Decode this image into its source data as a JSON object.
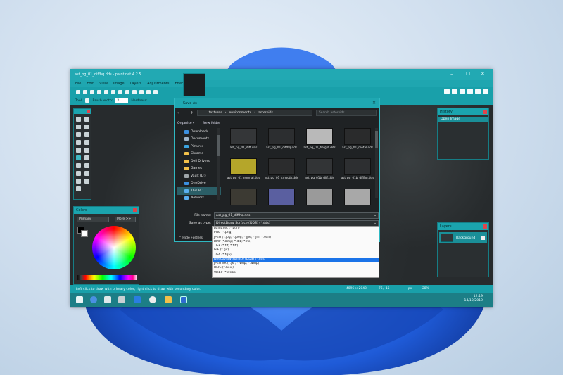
{
  "app": {
    "window_title": "ast_pg_01_diffhq.dds - paint.net 4.2.5",
    "menu": [
      "File",
      "Edit",
      "View",
      "Image",
      "Layers",
      "Adjustments",
      "Effects"
    ],
    "toolbar": {
      "tool_label": "Tool:",
      "brush_width_label": "Brush width:",
      "brush_width_value": "2",
      "hardness_label": "Hardness:"
    }
  },
  "panels": {
    "colors": {
      "title": "Colors",
      "primary_select": "Primary",
      "more_button": "More >>"
    },
    "history": {
      "title": "History",
      "items": [
        "Open Image"
      ]
    },
    "layers": {
      "title": "Layers",
      "items": [
        {
          "name": "Background"
        }
      ]
    }
  },
  "status_bar": {
    "hint": "Left click to draw with primary color, right click to draw with secondary color.",
    "image_size": "4096 × 2048",
    "coords": "76, -15",
    "unit": "px",
    "zoom": "28%"
  },
  "taskbar": {
    "time": "12:19",
    "date": "14/10/2019"
  },
  "save_dialog": {
    "title": "Save As",
    "breadcrumb": [
      "textures",
      "environments",
      "asteroids"
    ],
    "search_placeholder": "Search asteroids",
    "organise_label": "Organise ▾",
    "new_folder_label": "New folder",
    "nav_items": [
      {
        "label": "Downloads",
        "color": "#3b8fe0"
      },
      {
        "label": "Documents",
        "color": "#9fb4c8"
      },
      {
        "label": "Pictures",
        "color": "#3ba4e0"
      },
      {
        "label": "Chrome",
        "color": "#f2c04a"
      },
      {
        "label": "Dell Drivers",
        "color": "#f2c04a"
      },
      {
        "label": "Games",
        "color": "#f2c04a"
      },
      {
        "label": "Vault (D:)",
        "color": "#9fa6aa"
      },
      {
        "label": "OneDrive",
        "color": "#3b8fe0"
      },
      {
        "label": "This PC",
        "color": "#5ab0f0"
      },
      {
        "label": "Network",
        "color": "#5ab0f0"
      }
    ],
    "files": [
      {
        "name": "ast_pg_01_diff.dds",
        "thumb": "#343638"
      },
      {
        "name": "ast_pg_01_diffhq.dds",
        "thumb": "#2c2e30"
      },
      {
        "name": "ast_pg_01_height.dds",
        "thumb": "#b9b9b9"
      },
      {
        "name": "ast_pg_01_metal.dds",
        "thumb": "#2a2b2c"
      },
      {
        "name": "ast_pg_01_normal.dds",
        "thumb": "#b5a62a"
      },
      {
        "name": "ast_pg_01_smooth.dds",
        "thumb": "#2b2c2d"
      },
      {
        "name": "ast_pg_01b_diff.dds",
        "thumb": "#323436"
      },
      {
        "name": "ast_pg_01b_diffhq.dds",
        "thumb": "#2d2f31"
      },
      {
        "name": "",
        "thumb": "#3c3a33"
      },
      {
        "name": "",
        "thumb": "#5a5fa0"
      },
      {
        "name": "",
        "thumb": "#9a9a9a"
      },
      {
        "name": "",
        "thumb": "#a8a8a8"
      }
    ],
    "file_name_label": "File name:",
    "file_name_value": "ast_pg_01_diffhq.dds",
    "save_type_label": "Save as type:",
    "save_type_value": "DirectDraw Surface (DDS) (*.dds)",
    "hide_folders": "⌃ Hide Folders",
    "type_options": [
      "paint.net (*.pdn)",
      "PNG (*.png)",
      "JPEG (*.jpg; *.jpeg; *.jpe; *.jfif; *.exif)",
      "BMP (*.bmp; *.dib; *.rle)",
      "TIFF (*.tif; *.tiff)",
      "GIF (*.gif)",
      "TGA (*.tga)",
      "DirectDraw Surface (DDS) (*.dds)",
      "JPEG XR (*.jxr; *.wdp; *.wmp)",
      "HEIC (*.heic)",
      "WebP (*.webp)"
    ],
    "selected_option_index": 7
  },
  "colors_accent": {
    "teal": "#1fa8b2",
    "close_red": "#e0444c",
    "selection_blue": "#1a73e8"
  }
}
